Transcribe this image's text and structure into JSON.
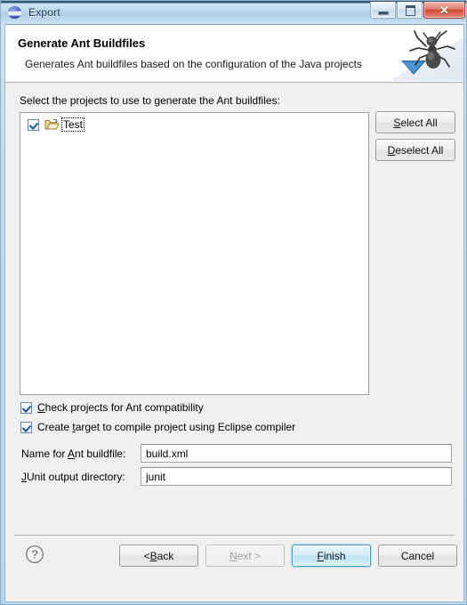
{
  "window": {
    "title": "Export",
    "icon": "eclipse-export-icon",
    "controls": {
      "minimize": "minimize-button",
      "maximize": "maximize-button",
      "close_glyph": "✕"
    }
  },
  "banner": {
    "title": "Generate Ant Buildfiles",
    "subtitle": "Generates Ant buildfiles based on the configuration of the Java projects",
    "icon": "ant-wizard-banner-icon"
  },
  "main": {
    "prompt_pre": "Select the projects to use to ",
    "prompt_mnemonic": "g",
    "prompt_post": "enerate the Ant buildfiles:",
    "tree": {
      "items": [
        {
          "label": "Test",
          "checked": true,
          "icon": "open-folder-icon",
          "focused": true
        }
      ]
    },
    "side_buttons": [
      {
        "name": "select-all-button",
        "pre": "",
        "mnemonic": "S",
        "post": "elect All"
      },
      {
        "name": "deselect-all-button",
        "pre": "",
        "mnemonic": "D",
        "post": "eselect All"
      }
    ],
    "options": [
      {
        "name": "check-ant-compatibility-checkbox",
        "checked": true,
        "pre": "",
        "mnemonic": "C",
        "post": "heck projects for Ant compatibility"
      },
      {
        "name": "create-eclipse-compiler-target-checkbox",
        "checked": true,
        "pre": "Create ",
        "mnemonic": "t",
        "post": "arget to compile project using Eclipse compiler"
      }
    ],
    "fields": [
      {
        "name": "ant-buildfile-name-field",
        "label_pre": "Name for ",
        "label_mnemonic": "A",
        "label_post": "nt buildfile:",
        "value": "build.xml",
        "placeholder": ""
      },
      {
        "name": "junit-output-directory-field",
        "label_pre": "",
        "label_mnemonic": "J",
        "label_post": "Unit output directory:",
        "value": "junit",
        "placeholder": ""
      }
    ]
  },
  "footer": {
    "help": "?",
    "buttons": [
      {
        "name": "back-button",
        "pre": "< ",
        "mnemonic": "B",
        "post": "ack",
        "state": "enabled"
      },
      {
        "name": "next-button",
        "pre": "",
        "mnemonic": "N",
        "post": "ext >",
        "state": "disabled"
      },
      {
        "name": "finish-button",
        "pre": "",
        "mnemonic": "F",
        "post": "inish",
        "state": "default"
      },
      {
        "name": "cancel-button",
        "pre": "Cancel",
        "mnemonic": "",
        "post": "",
        "state": "enabled"
      }
    ]
  },
  "colors": {
    "accent": "#3c9cc8",
    "title_gradient_top": "#cfe4f5",
    "close_button": "#cf4b38",
    "checkbox_check": "#2255a0",
    "banner_background": "#ffffff",
    "dialog_background": "#f0f0f0"
  }
}
